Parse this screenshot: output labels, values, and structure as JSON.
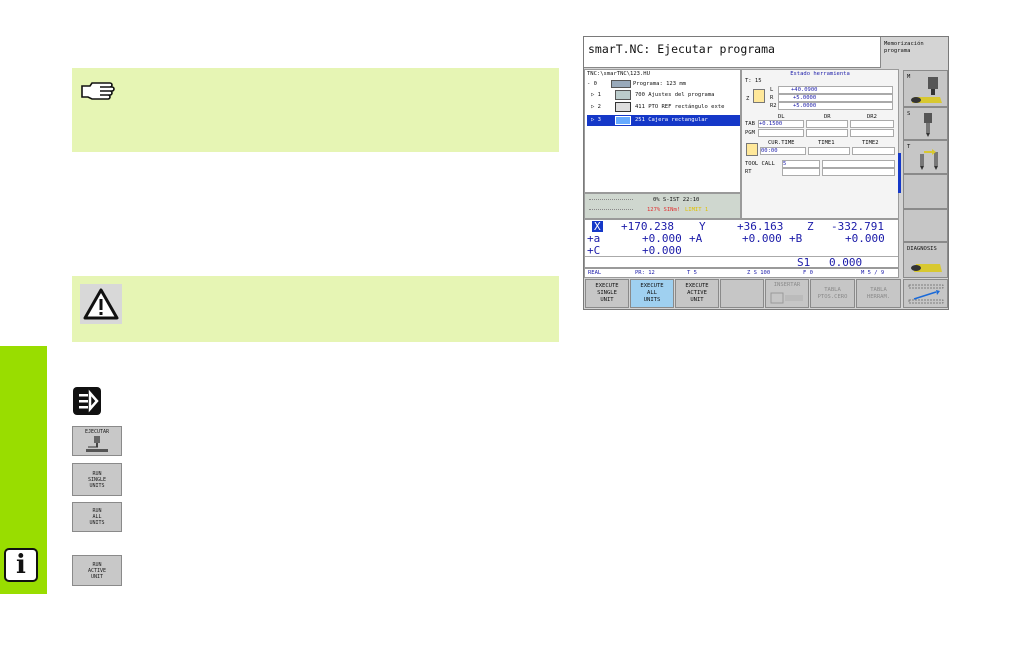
{
  "document": {
    "info_icon": "i",
    "run_single_icon": {
      "lines": [
        "RUN",
        "SINGLE",
        "UNITS"
      ]
    },
    "run_all_icon": {
      "lines": [
        "RUN",
        "ALL",
        "UNITS"
      ]
    },
    "run_active_icon": {
      "lines": [
        "RUN",
        "ACTIVE",
        "UNIT"
      ]
    },
    "ejecutar_icon_label": "EJECUTAR"
  },
  "cnc_screen": {
    "title": "smarT.NC: Ejecutar programa",
    "mode_label": "Memorización programa",
    "tree": {
      "path": "TNC:\\smarTNC\\123.HU",
      "rows": [
        {
          "prefix": "- 0",
          "text": "Programa: 123 mm",
          "selected": false
        },
        {
          "prefix": "▷ 1",
          "text": "700 Ajustes del programa",
          "selected": false
        },
        {
          "prefix": "▷ 2",
          "text": "411 PTO REF rectángulo exte",
          "selected": false
        },
        {
          "prefix": "▷ 3",
          "text": "251 Cajera rectangular",
          "selected": true
        }
      ]
    },
    "status_small": {
      "line1": "0% S-IST 22:10",
      "line2_red": "127% SINm!",
      "line2_yellow": "LIMIT 1"
    },
    "tool_status": {
      "header": "Estado herramienta",
      "t_label": "T: 15",
      "z_label": "Z",
      "l_label": "L",
      "l_value": "+40.0900",
      "r_label": "R",
      "r_value": "+5.0000",
      "r2_label": "R2",
      "r2_value": "+5.0000",
      "col_dl": "DL",
      "col_dr": "DR",
      "col_dr2": "DR2",
      "tab_label": "TAB",
      "tab_value": "+0.1500",
      "pgm_label": "PGM",
      "cur_time_label": "CUR.TIME",
      "time1_label": "TIME1",
      "time2_label": "TIME2",
      "cur_time_value": "00:00",
      "tool_call_label": "TOOL CALL",
      "tool_call_value": "5",
      "rt_label": "RT"
    },
    "positions": {
      "row1": {
        "axis1": "X",
        "val1": "+170.238",
        "axis2": "Y",
        "val2": "+36.163",
        "axis3": "Z",
        "val3": "-332.791"
      },
      "row2": {
        "axis1": "+a",
        "val1": "+0.000",
        "axis2": "+A",
        "val2": "+0.000",
        "axis3": "+B",
        "val3": "+0.000"
      },
      "row3": {
        "axis1": "+C",
        "val1": "+0.000"
      },
      "spindle_label": "S1",
      "spindle_value": "0.000"
    },
    "status_bar": {
      "real": "REAL",
      "pr": "PR: 12",
      "t": "T 5",
      "z": "Z S 100",
      "f": "F 0",
      "m": "M 5 / 9"
    },
    "side_keys": {
      "m": "M",
      "s": "S",
      "t": "T",
      "diagnosis": "DIAGNOSIS"
    },
    "softkeys": [
      {
        "lines": [
          "EXECUTE",
          "SINGLE",
          "UNIT"
        ]
      },
      {
        "lines": [
          "EXECUTE",
          "ALL",
          "UNITS"
        ]
      },
      {
        "lines": [
          "EXECUTE",
          "ACTIVE",
          "UNIT"
        ]
      },
      {
        "lines": [
          ""
        ]
      },
      {
        "lines": [
          "INSERTAR"
        ]
      },
      {
        "lines": [
          "TABLA",
          "PTOS.CERO"
        ]
      },
      {
        "lines": [
          "TABLA",
          "HERRAM."
        ]
      },
      {
        "lines": [
          ""
        ]
      }
    ]
  }
}
